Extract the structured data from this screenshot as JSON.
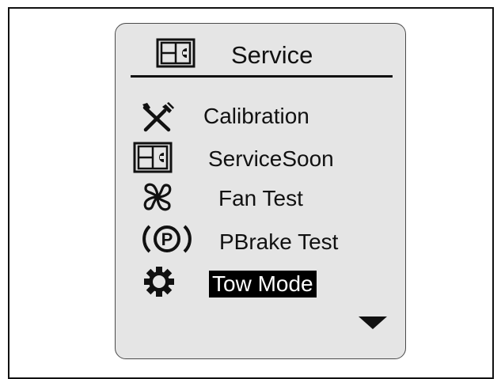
{
  "screen": {
    "title": "Service",
    "title_icon": "service-book-icon"
  },
  "menu": {
    "items": [
      {
        "label": "Calibration",
        "icon": "wrench-screwdriver-icon",
        "selected": false
      },
      {
        "label": "ServiceSoon",
        "icon": "service-book-icon",
        "selected": false
      },
      {
        "label": "Fan Test",
        "icon": "fan-icon",
        "selected": false
      },
      {
        "label": "PBrake Test",
        "icon": "parking-brake-icon",
        "selected": false
      },
      {
        "label": "Tow Mode",
        "icon": "gear-icon",
        "selected": true
      }
    ]
  },
  "scroll": {
    "icon": "scroll-down-arrow-icon"
  },
  "colors": {
    "screen_bg": "#e5e5e5",
    "ink": "#111111",
    "highlight_bg": "#000000",
    "highlight_text": "#ffffff"
  }
}
